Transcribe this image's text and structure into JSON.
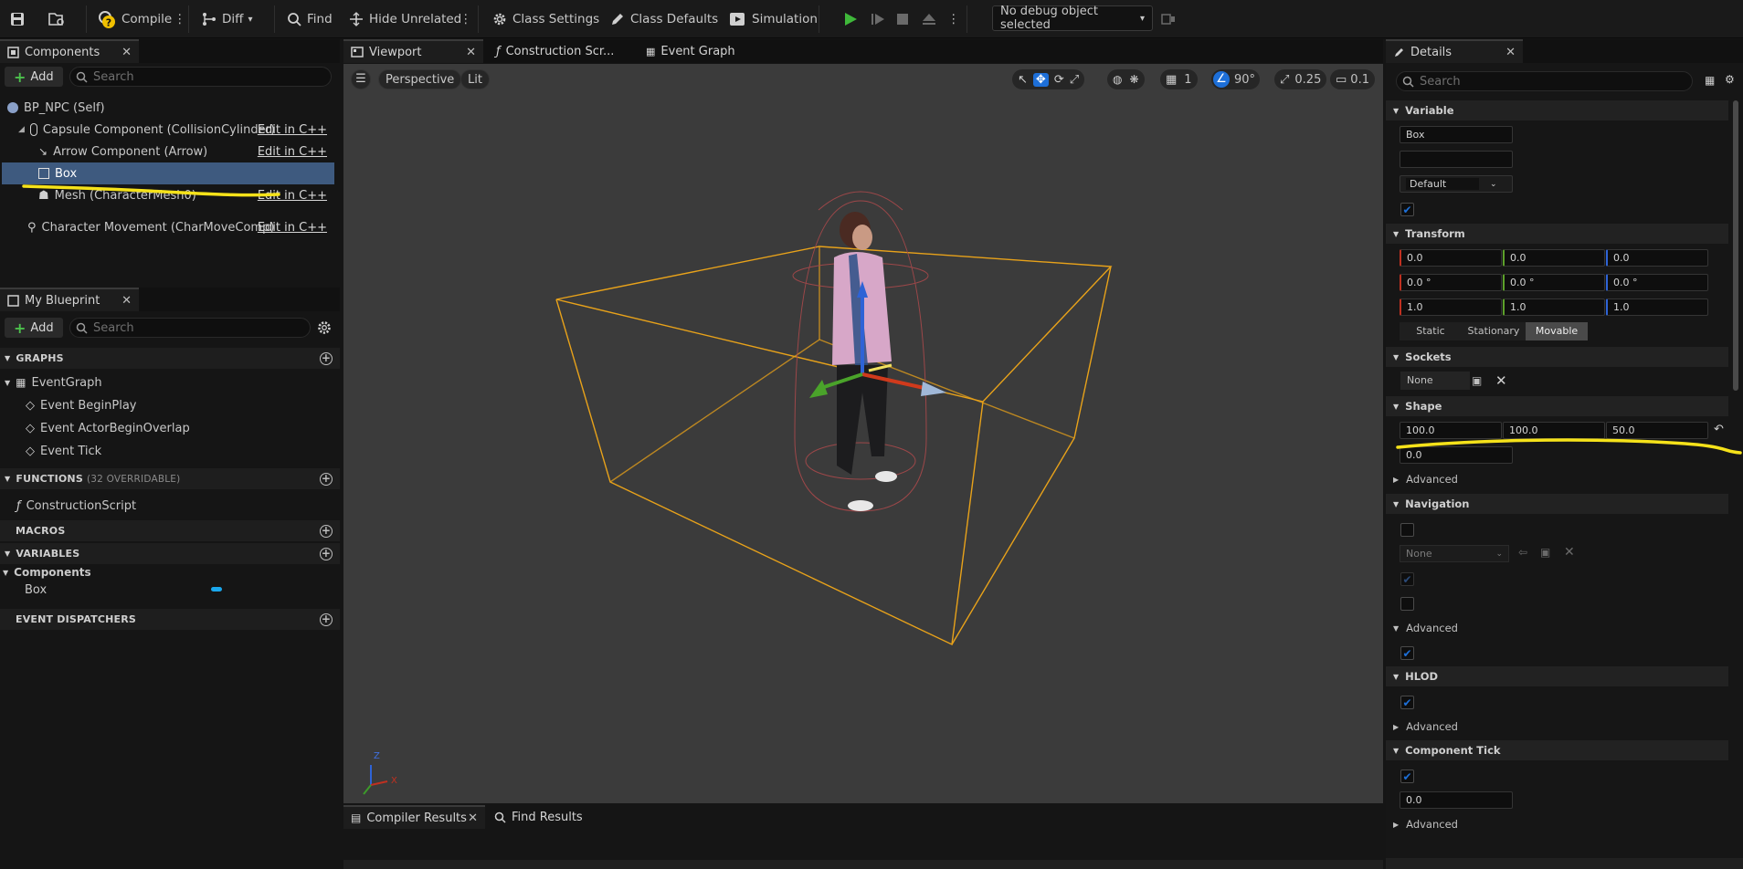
{
  "toolbar": {
    "compile": "Compile",
    "diff": "Diff",
    "find": "Find",
    "hide_unrelated": "Hide Unrelated",
    "class_settings": "Class Settings",
    "class_defaults": "Class Defaults",
    "simulation": "Simulation",
    "debug_object": "No debug object selected"
  },
  "components_panel": {
    "tab": "Components",
    "add_label": "Add",
    "search_placeholder": "Search",
    "items": [
      {
        "label": "BP_NPC (Self)"
      },
      {
        "label": "Capsule Component (CollisionCylinder)",
        "action": "Edit in C++"
      },
      {
        "label": "Arrow Component (Arrow)",
        "action": "Edit in C++"
      },
      {
        "label": "Box"
      },
      {
        "label": "Mesh (CharacterMesh0)",
        "action": "Edit in C++"
      },
      {
        "label": "Character Movement (CharMoveComp)",
        "action": "Edit in C++"
      }
    ]
  },
  "blueprint_panel": {
    "tab": "My Blueprint",
    "add_label": "Add",
    "search_placeholder": "Search",
    "graphs": "GRAPHS",
    "event_graph": "EventGraph",
    "events": [
      "Event BeginPlay",
      "Event ActorBeginOverlap",
      "Event Tick"
    ],
    "functions": "FUNCTIONS",
    "functions_note": "(32 OVERRIDABLE)",
    "construction_script": "ConstructionScript",
    "macros": "MACROS",
    "variables": "VARIABLES",
    "components_cat": "Components",
    "box_var": "Box",
    "dispatchers": "EVENT DISPATCHERS"
  },
  "editor_tabs": {
    "viewport": "Viewport",
    "construction": "Construction Scr...",
    "event_graph": "Event Graph"
  },
  "viewport": {
    "perspective": "Perspective",
    "lit": "Lit",
    "grid_snap": "1",
    "rot_snap": "90°",
    "scale_snap": "0.25",
    "cam_speed": "0.1",
    "axis_x": "X",
    "axis_z": "Z"
  },
  "bottom_tabs": {
    "compiler": "Compiler Results",
    "find": "Find Results"
  },
  "details": {
    "tab": "Details",
    "search_placeholder": "Search",
    "variable": "Variable",
    "var_name": "Box",
    "var_default": "Default",
    "transform": "Transform",
    "location": [
      "0.0",
      "0.0",
      "0.0"
    ],
    "rotation": [
      "0.0 °",
      "0.0 °",
      "0.0 °"
    ],
    "scale": [
      "1.0",
      "1.0",
      "1.0"
    ],
    "mobility": [
      "Static",
      "Stationary",
      "Movable"
    ],
    "sockets": "Sockets",
    "socket_value": "None",
    "shape": "Shape",
    "extent": [
      "100.0",
      "100.0",
      "50.0"
    ],
    "line_thickness": "0.0",
    "advanced": "Advanced",
    "navigation": "Navigation",
    "nav_none": "None",
    "hlod": "HLOD",
    "component_tick": "Component Tick",
    "tick_interval": "0.0"
  },
  "colors": {
    "selection": "#3e5a7f",
    "accent_blue": "#1d6fd8",
    "box_wire": "#e8a21a",
    "annotation": "#f5e21a"
  }
}
